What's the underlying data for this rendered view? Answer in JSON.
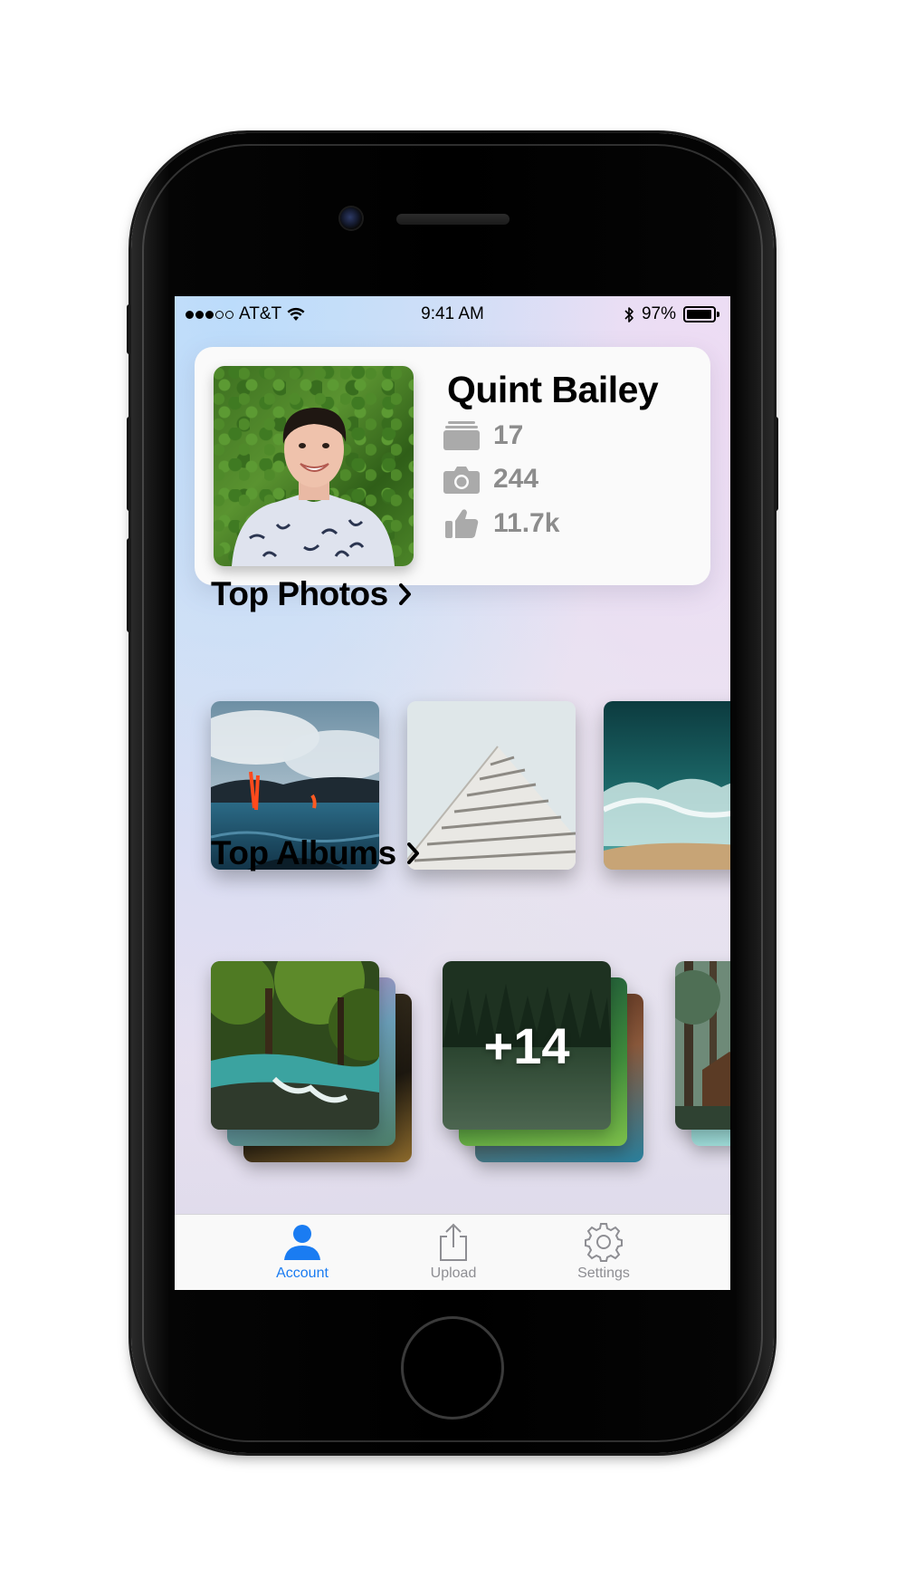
{
  "status_bar": {
    "carrier": "AT&T",
    "time": "9:41 AM",
    "battery_percent": "97%",
    "battery_level": 0.97,
    "signal_bars_filled": 3,
    "signal_bars_total": 5
  },
  "profile": {
    "name": "Quint Bailey",
    "stats": [
      {
        "icon": "album-stack-icon",
        "value": "17"
      },
      {
        "icon": "camera-icon",
        "value": "244"
      },
      {
        "icon": "thumbs-up-icon",
        "value": "11.7k"
      }
    ]
  },
  "top_photos": {
    "title": "Top Photos"
  },
  "top_albums": {
    "title": "Top Albums",
    "extra_count": "+14"
  },
  "tab_bar": {
    "tabs": [
      {
        "label": "Account",
        "icon": "person-icon",
        "active": true
      },
      {
        "label": "Upload",
        "icon": "share-upload-icon",
        "active": false
      },
      {
        "label": "Settings",
        "icon": "gear-icon",
        "active": false
      }
    ],
    "active_color": "#1a7cf2",
    "inactive_color": "#8e8e93"
  }
}
